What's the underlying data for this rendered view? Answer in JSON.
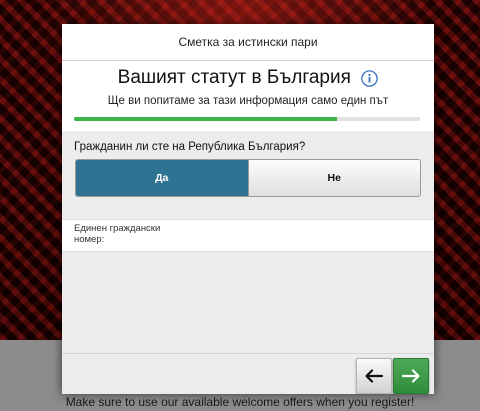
{
  "modal": {
    "header_title": "Сметка за истински пари",
    "title": "Вашият статут в България",
    "subtitle": "Ще ви попитаме за тази информация само един път",
    "progress": 0.76
  },
  "question": {
    "label": "Гражданин ли сте на Република България?",
    "options": [
      "Да",
      "Не"
    ],
    "selected": "Да"
  },
  "egn": {
    "label": "Единен граждански номер:",
    "value": "",
    "placeholder": ""
  },
  "footer": {
    "back_icon": "arrow-left-icon",
    "next_icon": "arrow-right-icon"
  },
  "promo_text": "Make sure to use our available welcome offers when you register!",
  "colors": {
    "selected_option": "#2f7392",
    "progress": "#3bb54a",
    "next_button": "#3a9b45"
  }
}
